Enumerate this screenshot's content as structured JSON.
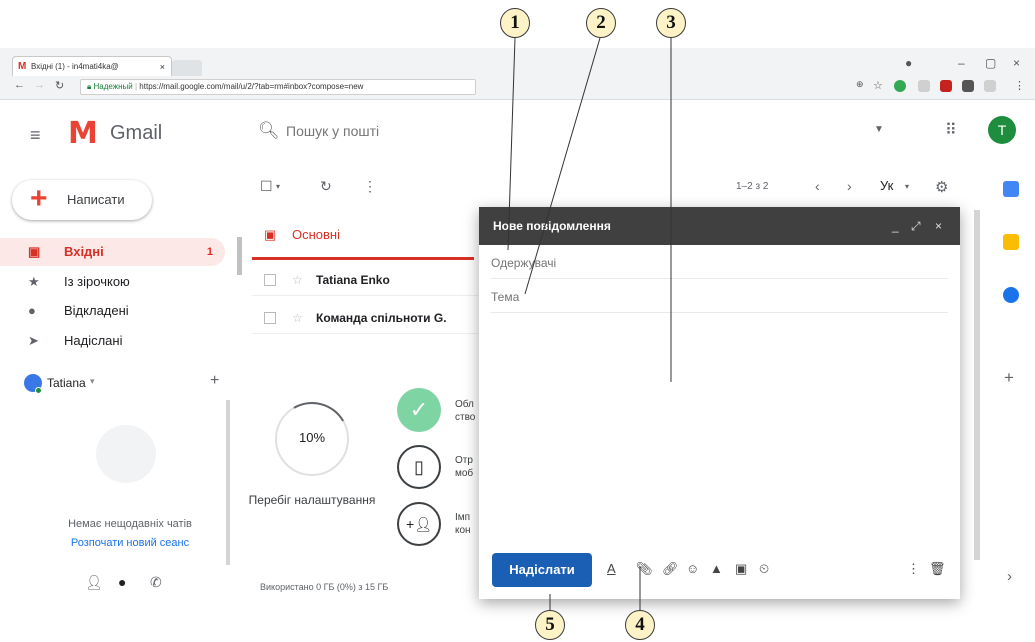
{
  "callouts": [
    "1",
    "2",
    "3",
    "4",
    "5"
  ],
  "browser": {
    "tab_title": "Вхідні (1) - in4mati4ka@",
    "tab_close": "×",
    "secure_label": "Надежный",
    "url": "https://mail.google.com/mail/u/2/?tab=rm#inbox?compose=new",
    "controls": {
      "min": "–",
      "max": "▢",
      "close": "×"
    }
  },
  "gmail": {
    "logo_text": "Gmail",
    "search_placeholder": "Пошук у пошті",
    "avatar_letter": "T",
    "compose_label": "Написати",
    "sidebar": [
      {
        "label": "Вхідні",
        "icon": "inbox-icon",
        "count": "1"
      },
      {
        "label": "Із зірочкою",
        "icon": "star-icon"
      },
      {
        "label": "Відкладені",
        "icon": "clock-icon"
      },
      {
        "label": "Надіслані",
        "icon": "send-icon"
      }
    ],
    "user_name": "Tatiana",
    "no_chats": "Немає нещодавніх чатів",
    "new_session": "Розпочати новий сеанс",
    "pager": "1–2 з 2",
    "lang": "Ук",
    "primary_tab": "Основні",
    "emails": [
      {
        "sender": "Tatiana Enko"
      },
      {
        "sender": "Команда спільноти G."
      }
    ],
    "progress": {
      "value": "10%",
      "fraction": 0.1,
      "label": "Перебіг налаштування"
    },
    "setup_items": [
      {
        "line1": "Обл",
        "line2": "ство"
      },
      {
        "line1": "Отр",
        "line2": "моб"
      },
      {
        "line1": "Імп",
        "line2": "кон"
      }
    ],
    "usage": "Використано 0 ГБ (0%) з 15 ГБ"
  },
  "compose": {
    "title": "Нове повідомлення",
    "to_placeholder": "Одержувачі",
    "subject_placeholder": "Тема",
    "send_label": "Надіслати"
  }
}
